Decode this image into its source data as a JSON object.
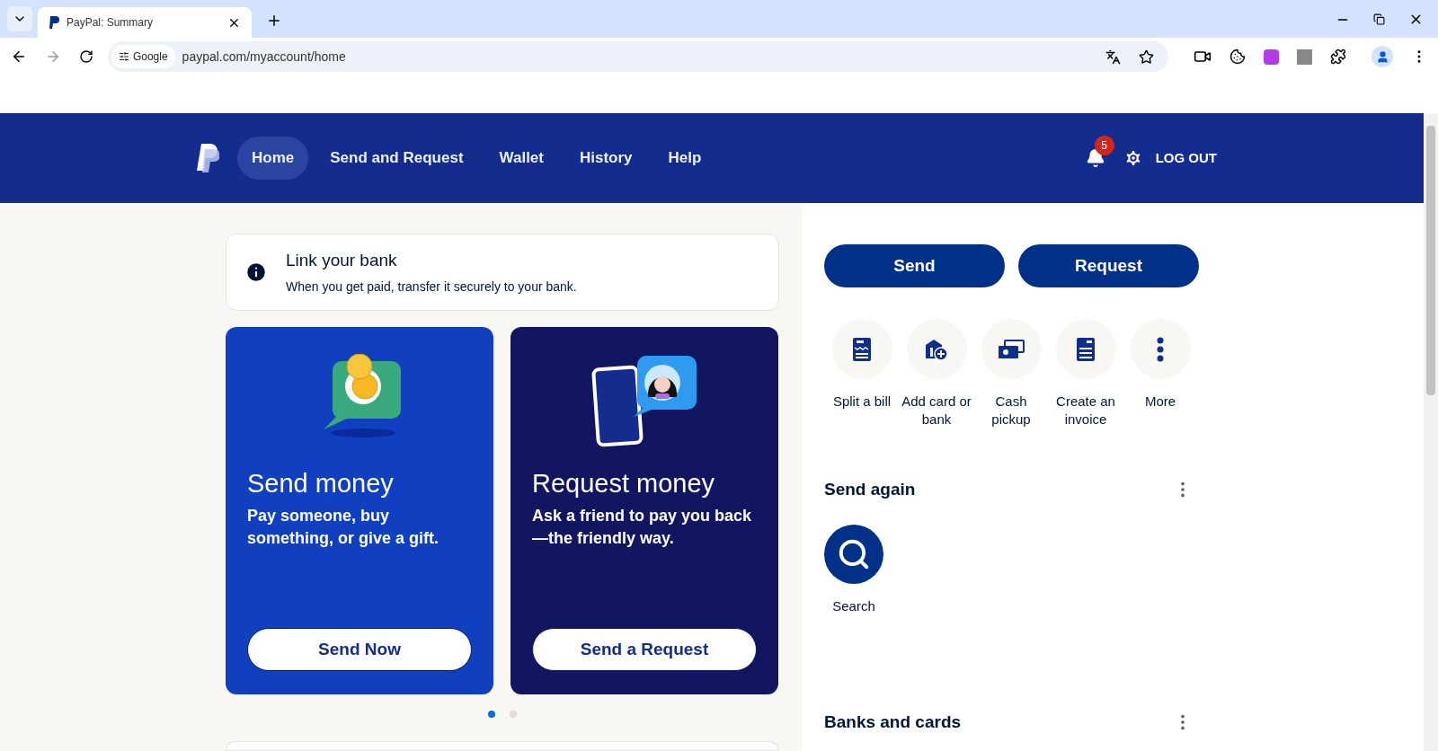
{
  "browser": {
    "tab_title": "PayPal: Summary",
    "chip": "Google",
    "url": "paypal.com/myaccount/home"
  },
  "nav": {
    "items": [
      {
        "label": "Home",
        "selected": true
      },
      {
        "label": "Send and Request",
        "selected": false
      },
      {
        "label": "Wallet",
        "selected": false
      },
      {
        "label": "History",
        "selected": false
      },
      {
        "label": "Help",
        "selected": false
      }
    ],
    "notifications": "5",
    "logout": "LOG OUT"
  },
  "banner": {
    "title": "Link your bank",
    "text": "When you get paid, transfer it securely to your bank."
  },
  "promo_cards": [
    {
      "kind": "send",
      "title": "Send money",
      "text": "Pay someone, buy something, or give a gift.",
      "button": "Send Now"
    },
    {
      "kind": "request",
      "title": "Request money",
      "text": "Ask a friend to pay you back —the friendly way.",
      "button": "Send a Request"
    }
  ],
  "carousel_dots": [
    {
      "selected": true
    },
    {
      "selected": false
    }
  ],
  "actions": {
    "primary": [
      "Send",
      "Request"
    ],
    "quick": [
      {
        "kind": "split",
        "label": "Split a bill"
      },
      {
        "kind": "bank",
        "label": "Add card or bank"
      },
      {
        "kind": "cash",
        "label": "Cash pickup"
      },
      {
        "kind": "invoice",
        "label": "Create an invoice"
      },
      {
        "kind": "more",
        "label": "More"
      }
    ]
  },
  "send_again": {
    "title": "Send again",
    "contacts": [
      {
        "label": "Search"
      }
    ]
  },
  "banks_and_cards": {
    "title": "Banks and cards"
  }
}
